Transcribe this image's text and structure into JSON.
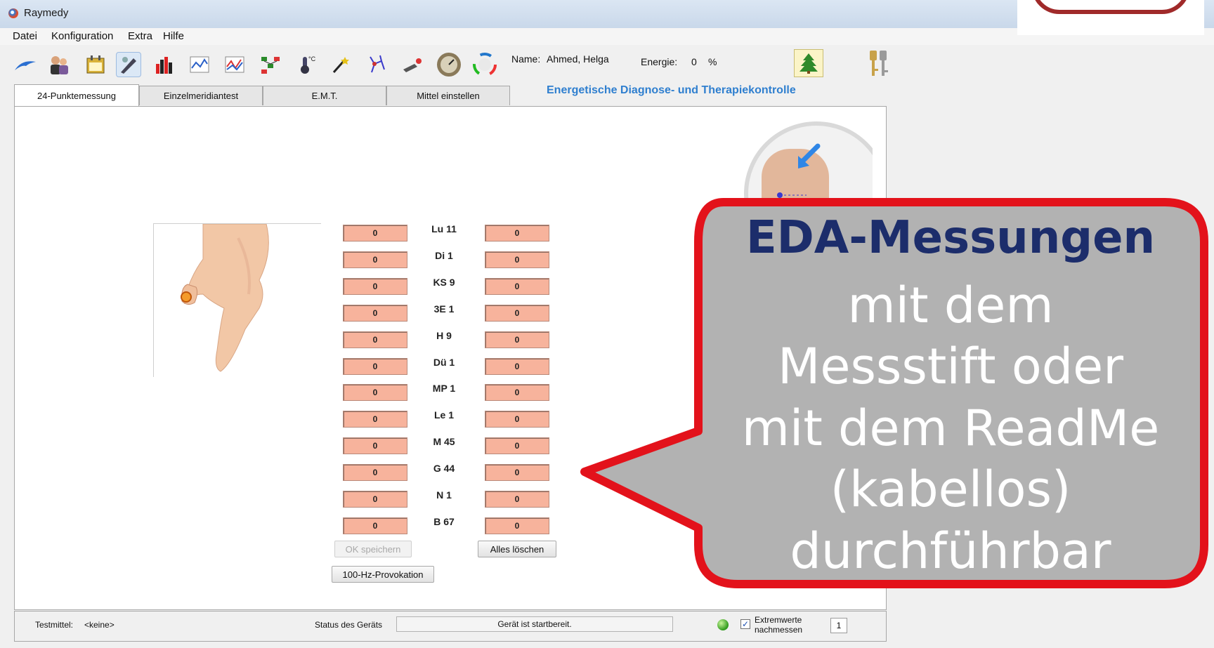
{
  "window": {
    "title": "Raymedy"
  },
  "menu": [
    "Datei",
    "Konfiguration",
    "Extra",
    "Hilfe"
  ],
  "toolbar": {
    "icons": [
      "dolphin-icon",
      "people-icon",
      "calendar-icon",
      "measure-pen-icon",
      "bar-chart-icon",
      "line-chart-icon",
      "graph-icon",
      "network-icon",
      "temperature-icon",
      "magic-wand-icon",
      "molecule-icon",
      "pipette-icon",
      "gauge-icon",
      "color-wheel-icon"
    ],
    "name_label": "Name:",
    "name_value": "Ahmed, Helga",
    "energy_label": "Energie:",
    "energy_value": "0",
    "energy_unit": "%"
  },
  "tabs": [
    "24-Punktemessung",
    "Einzelmeridiantest",
    "E.M.T.",
    "Mittel einstellen"
  ],
  "heading": "Energetische Diagnose- und Therapiekontrolle",
  "points": [
    {
      "label": "Lu 11",
      "left": "0",
      "right": "0"
    },
    {
      "label": "Di 1",
      "left": "0",
      "right": "0"
    },
    {
      "label": "KS 9",
      "left": "0",
      "right": "0"
    },
    {
      "label": "3E 1",
      "left": "0",
      "right": "0"
    },
    {
      "label": "H 9",
      "left": "0",
      "right": "0"
    },
    {
      "label": "Dü 1",
      "left": "0",
      "right": "0"
    },
    {
      "label": "MP 1",
      "left": "0",
      "right": "0"
    },
    {
      "label": "Le 1",
      "left": "0",
      "right": "0"
    },
    {
      "label": "M 45",
      "left": "0",
      "right": "0"
    },
    {
      "label": "G 44",
      "left": "0",
      "right": "0"
    },
    {
      "label": "N 1",
      "left": "0",
      "right": "0"
    },
    {
      "label": "B 67",
      "left": "0",
      "right": "0"
    }
  ],
  "buttons": {
    "ok": "OK speichern",
    "clear": "Alles löschen",
    "provocation": "100-Hz-Provokation"
  },
  "status": {
    "test_label": "Testmittel:",
    "test_value": "<keine>",
    "device_label": "Status des Geräts",
    "device_value": "Gerät ist startbereit.",
    "checkbox_line1": "Extremwerte",
    "checkbox_line2": "nachmessen",
    "checkbox_mark": "✓",
    "spin_value": "1"
  },
  "callout": {
    "title": "EDA-Messungen",
    "lines": [
      "mit dem",
      "Messstift oder",
      "mit dem ReadMe",
      "(kabellos)",
      "durchführbar"
    ]
  },
  "colors": {
    "accent_blue": "#2f7fcf",
    "callout_border": "#e3121b",
    "callout_fill": "#b2b2b2",
    "callout_title": "#1c2d6b",
    "measure_box": "#f7b39c"
  }
}
